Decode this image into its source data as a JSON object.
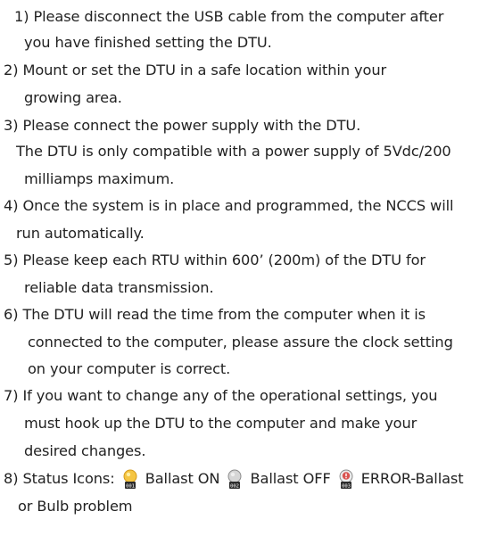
{
  "items": [
    {
      "lines": [
        "1) Please disconnect the USB cable from the computer after",
        "you have finished setting the DTU."
      ]
    },
    {
      "lines": [
        "2) Mount or set the DTU in a safe location within your",
        "growing area."
      ]
    },
    {
      "lines": [
        "3) Please connect the power supply with the DTU.",
        "The DTU is only compatible with a power supply of 5Vdc/200",
        "milliamps maximum."
      ]
    },
    {
      "lines": [
        "4) Once the system is in place and programmed, the NCCS will",
        "run  automatically."
      ]
    },
    {
      "lines": [
        "5) Please keep each RTU within 600’ (200m) of the DTU for",
        "reliable data transmission."
      ]
    },
    {
      "lines": [
        "6) The DTU will read the time from the computer when it is",
        "connected to the computer, please assure the clock setting",
        "on your computer is correct."
      ]
    },
    {
      "lines": [
        "7) If you want to change any of the operational settings, you",
        "must hook up the DTU to the computer and make your",
        "desired changes."
      ]
    }
  ],
  "status": {
    "prefix": "8) Status Icons:",
    "on_label": "Ballast ON",
    "off_label": "Ballast OFF",
    "error_label": "ERROR-Ballast",
    "continuation": "or Bulb problem",
    "on_code": "001",
    "off_code": "002",
    "error_code": "003",
    "on_icon": "bulb-on-icon",
    "off_icon": "bulb-off-icon",
    "error_icon": "bulb-error-icon",
    "on_color": "#f5c542",
    "off_color": "#c8c8c8",
    "error_color": "#d9534f"
  }
}
